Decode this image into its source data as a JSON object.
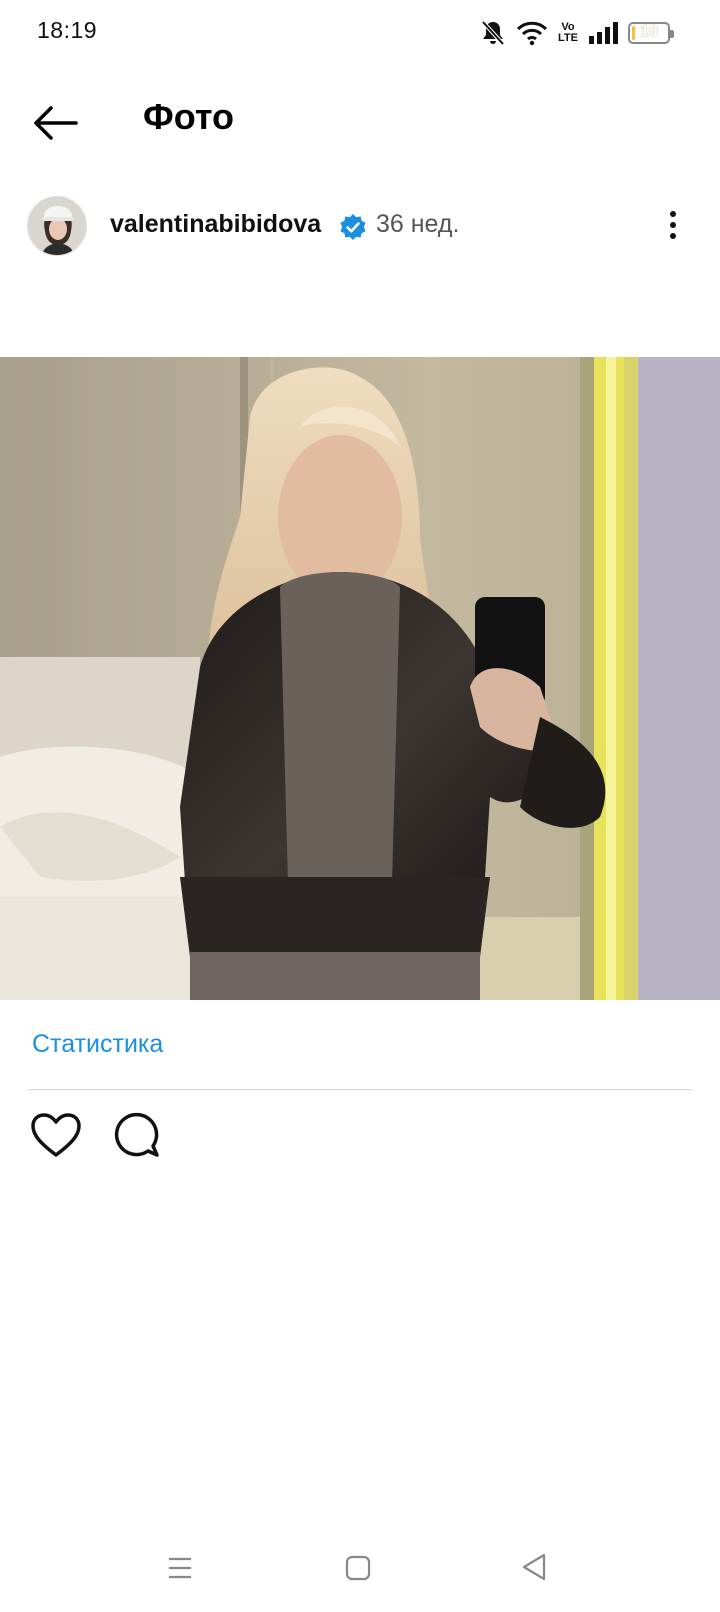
{
  "status_bar": {
    "time": "18:19",
    "icons": [
      "bell-muted-icon",
      "wifi-icon",
      "volte-icon",
      "signal-icon",
      "battery-icon"
    ],
    "volte_top": "Vo",
    "volte_bottom": "LTE",
    "battery_level": "10",
    "battery_fraction": 0.1,
    "battery_color": "#f5c33b"
  },
  "header": {
    "back_icon": "arrow-left-icon",
    "title": "Фото"
  },
  "post": {
    "username": "valentinabibidova",
    "verified_icon": "verified-badge-icon",
    "verified_color": "#1a8fe0",
    "age": "36 нед.",
    "more_icon": "more-vertical-icon"
  },
  "actions": {
    "statistics_label": "Статистика",
    "statistics_color": "#1a8fe0",
    "like_icon": "heart-icon",
    "comment_icon": "comment-icon"
  },
  "nav_bar": {
    "icons": [
      "menu-icon",
      "home-square-icon",
      "back-triangle-icon"
    ]
  }
}
